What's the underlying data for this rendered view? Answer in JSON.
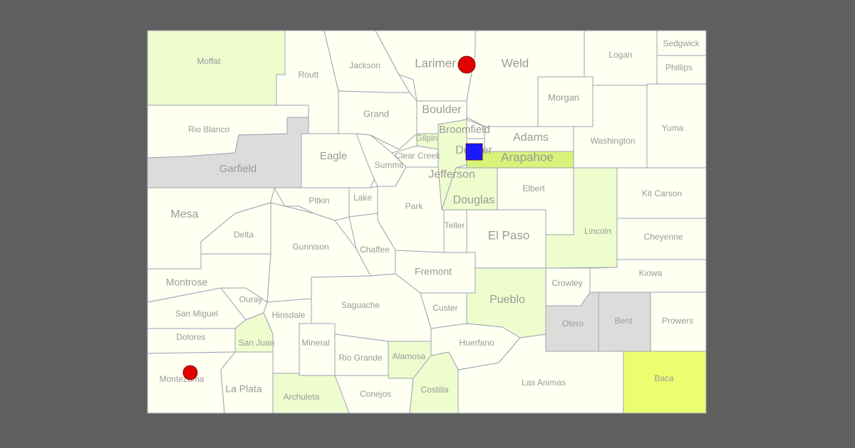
{
  "map": {
    "colors": {
      "default": "#fffff2",
      "light_green": "#effcce",
      "green": "#d9f27a",
      "yellow": "#ebff6e",
      "gray": "#dcdddb",
      "border": "#9aa3b5",
      "label": "#9a9a9a",
      "marker_red": "#e00000",
      "marker_blue": "#1a1aff"
    },
    "counties": [
      {
        "name": "Moffat",
        "fill": "light_green"
      },
      {
        "name": "Routt",
        "fill": "default"
      },
      {
        "name": "Jackson",
        "fill": "default"
      },
      {
        "name": "Larimer",
        "fill": "default"
      },
      {
        "name": "Weld",
        "fill": "default"
      },
      {
        "name": "Logan",
        "fill": "default"
      },
      {
        "name": "Sedgwick",
        "fill": "default"
      },
      {
        "name": "Phillips",
        "fill": "default"
      },
      {
        "name": "Morgan",
        "fill": "default"
      },
      {
        "name": "Washington",
        "fill": "default"
      },
      {
        "name": "Yuma",
        "fill": "default"
      },
      {
        "name": "Rio Blanco",
        "fill": "default"
      },
      {
        "name": "Garfield",
        "fill": "gray"
      },
      {
        "name": "Grand",
        "fill": "default"
      },
      {
        "name": "Boulder",
        "fill": "default"
      },
      {
        "name": "Gilpin",
        "fill": "light_green"
      },
      {
        "name": "Clear Creek",
        "fill": "default"
      },
      {
        "name": "Eagle",
        "fill": "default"
      },
      {
        "name": "Summit",
        "fill": "default"
      },
      {
        "name": "Jefferson",
        "fill": "light_green"
      },
      {
        "name": "Adams",
        "fill": "default"
      },
      {
        "name": "Broomfield",
        "fill": "default"
      },
      {
        "name": "Arapahoe",
        "fill": "green"
      },
      {
        "name": "Denver",
        "fill": "default"
      },
      {
        "name": "Douglas",
        "fill": "light_green"
      },
      {
        "name": "Elbert",
        "fill": "default"
      },
      {
        "name": "Lincoln",
        "fill": "light_green"
      },
      {
        "name": "Kit Carson",
        "fill": "default"
      },
      {
        "name": "Cheyenne",
        "fill": "default"
      },
      {
        "name": "Kiowa",
        "fill": "default"
      },
      {
        "name": "Prowers",
        "fill": "default"
      },
      {
        "name": "Bent",
        "fill": "gray"
      },
      {
        "name": "Otero",
        "fill": "gray"
      },
      {
        "name": "Crowley",
        "fill": "default"
      },
      {
        "name": "Baca",
        "fill": "yellow"
      },
      {
        "name": "Las Animas",
        "fill": "default"
      },
      {
        "name": "Pueblo",
        "fill": "light_green"
      },
      {
        "name": "El Paso",
        "fill": "default"
      },
      {
        "name": "Teller",
        "fill": "default"
      },
      {
        "name": "Fremont",
        "fill": "default"
      },
      {
        "name": "Park",
        "fill": "default"
      },
      {
        "name": "Lake",
        "fill": "default"
      },
      {
        "name": "Chaffee",
        "fill": "default"
      },
      {
        "name": "Pitkin",
        "fill": "default"
      },
      {
        "name": "Mesa",
        "fill": "default"
      },
      {
        "name": "Delta",
        "fill": "default"
      },
      {
        "name": "Gunnison",
        "fill": "default"
      },
      {
        "name": "Montrose",
        "fill": "default"
      },
      {
        "name": "Ouray",
        "fill": "default"
      },
      {
        "name": "San Miguel",
        "fill": "default"
      },
      {
        "name": "Hinsdale",
        "fill": "default"
      },
      {
        "name": "San Juan",
        "fill": "light_green"
      },
      {
        "name": "Dolores",
        "fill": "default"
      },
      {
        "name": "Montezuma",
        "fill": "default"
      },
      {
        "name": "La Plata",
        "fill": "default"
      },
      {
        "name": "Archuleta",
        "fill": "light_green"
      },
      {
        "name": "Mineral",
        "fill": "default"
      },
      {
        "name": "Saguache",
        "fill": "default"
      },
      {
        "name": "Rio Grande",
        "fill": "default"
      },
      {
        "name": "Alamosa",
        "fill": "light_green"
      },
      {
        "name": "Conejos",
        "fill": "default"
      },
      {
        "name": "Costilla",
        "fill": "light_green"
      },
      {
        "name": "Custer",
        "fill": "default"
      },
      {
        "name": "Huerfano",
        "fill": "default"
      }
    ],
    "markers": [
      {
        "county": "Larimer",
        "shape": "circle",
        "color": "marker_red"
      },
      {
        "county": "Montezuma",
        "shape": "circle",
        "color": "marker_red"
      },
      {
        "county": "Denver",
        "shape": "square",
        "color": "marker_blue"
      }
    ]
  }
}
